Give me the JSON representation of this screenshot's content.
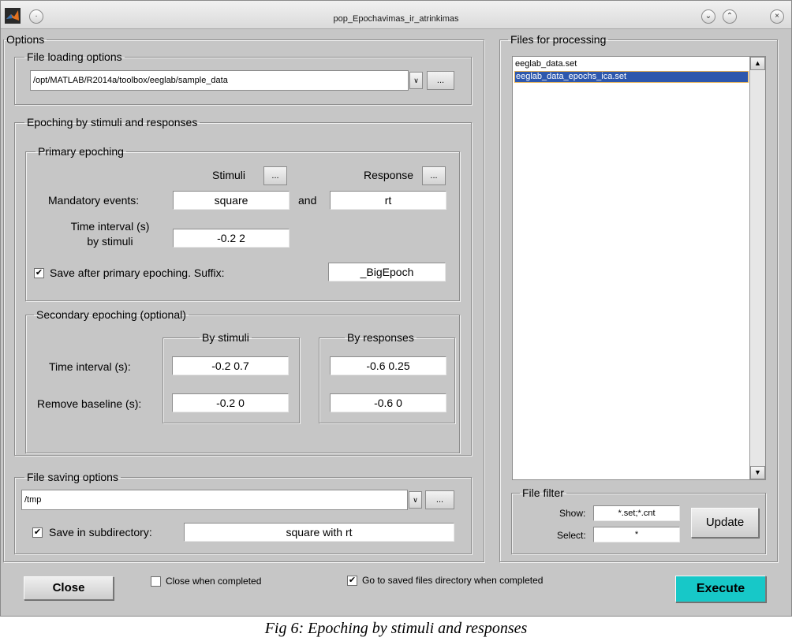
{
  "window": {
    "title": "pop_Epochavimas_ir_atrinkimas",
    "minimize_symbol": "⌄",
    "maximize_symbol": "⌃",
    "close_symbol": "×",
    "menu_symbol": "·"
  },
  "options": {
    "legend": "Options",
    "file_loading": {
      "legend": "File loading options",
      "path": "/opt/MATLAB/R2014a/toolbox/eeglab/sample_data",
      "browse_label": "..."
    },
    "epoching": {
      "legend": "Epoching by stimuli and responses",
      "primary": {
        "legend": "Primary epoching",
        "stimuli_label": "Stimuli",
        "response_label": "Response",
        "browse_label": "...",
        "mandatory_events_label": "Mandatory events:",
        "stimuli_value": "square",
        "and_label": "and",
        "response_value": "rt",
        "time_interval_label_line1": "Time interval (s)",
        "time_interval_label_line2": "by stimuli",
        "time_interval_value": "-0.2 2",
        "save_label": "Save after primary epoching. Suffix:",
        "save_checked": true,
        "suffix_value": "_BigEpoch"
      },
      "secondary": {
        "legend": "Secondary epoching (optional)",
        "by_stimuli_legend": "By stimuli",
        "by_responses_legend": "By responses",
        "time_interval_label": "Time interval (s):",
        "remove_baseline_label": "Remove baseline (s):",
        "stim_time_interval": "-0.2 0.7",
        "stim_remove_baseline": "-0.2 0",
        "resp_time_interval": "-0.6 0.25",
        "resp_remove_baseline": "-0.6 0"
      }
    },
    "file_saving": {
      "legend": "File saving options",
      "path": "/tmp",
      "browse_label": "...",
      "subdir_label": "Save in subdirectory:",
      "subdir_checked": true,
      "subdir_value": "square with rt"
    }
  },
  "files": {
    "legend": "Files for processing",
    "items": [
      {
        "name": "eeglab_data.set",
        "selected": false
      },
      {
        "name": "eeglab_data_epochs_ica.set",
        "selected": true
      }
    ],
    "filter": {
      "legend": "File filter",
      "show_label": "Show:",
      "show_value": "*.set;*.cnt",
      "select_label": "Select:",
      "select_value": "*",
      "update_label": "Update"
    }
  },
  "footer": {
    "close_label": "Close",
    "close_when_completed_label": "Close when completed",
    "close_when_completed_checked": false,
    "goto_saved_label": "Go to saved files directory when completed",
    "goto_saved_checked": true,
    "execute_label": "Execute",
    "execute_color": "#17c8c8"
  },
  "caption": "Fig 6: Epoching by stimuli and responses"
}
